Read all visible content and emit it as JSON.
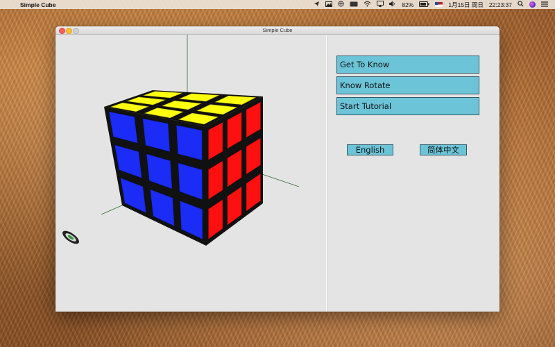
{
  "menubar": {
    "apple_glyph": "",
    "app_name": "Simple Cube",
    "battery": "82%",
    "date": "1月15日 周日",
    "time": "22:23:37"
  },
  "window": {
    "title": "Simple Cube"
  },
  "menu": {
    "get_to_know": "Get To Know",
    "know_rotate": "Know Rotate",
    "start_tutorial": "Start Tutorial"
  },
  "language": {
    "english": "English",
    "chinese": "简体中文"
  },
  "cube": {
    "front_color": "#1a2cf5",
    "right_color": "#ff1010",
    "top_color": "#ffff10",
    "sticker_border": "#111111"
  },
  "colors": {
    "button_bg": "#6bc4d8",
    "button_border": "#345a68",
    "window_bg": "#e4e4e4",
    "axis_color": "#2e6b2e"
  }
}
